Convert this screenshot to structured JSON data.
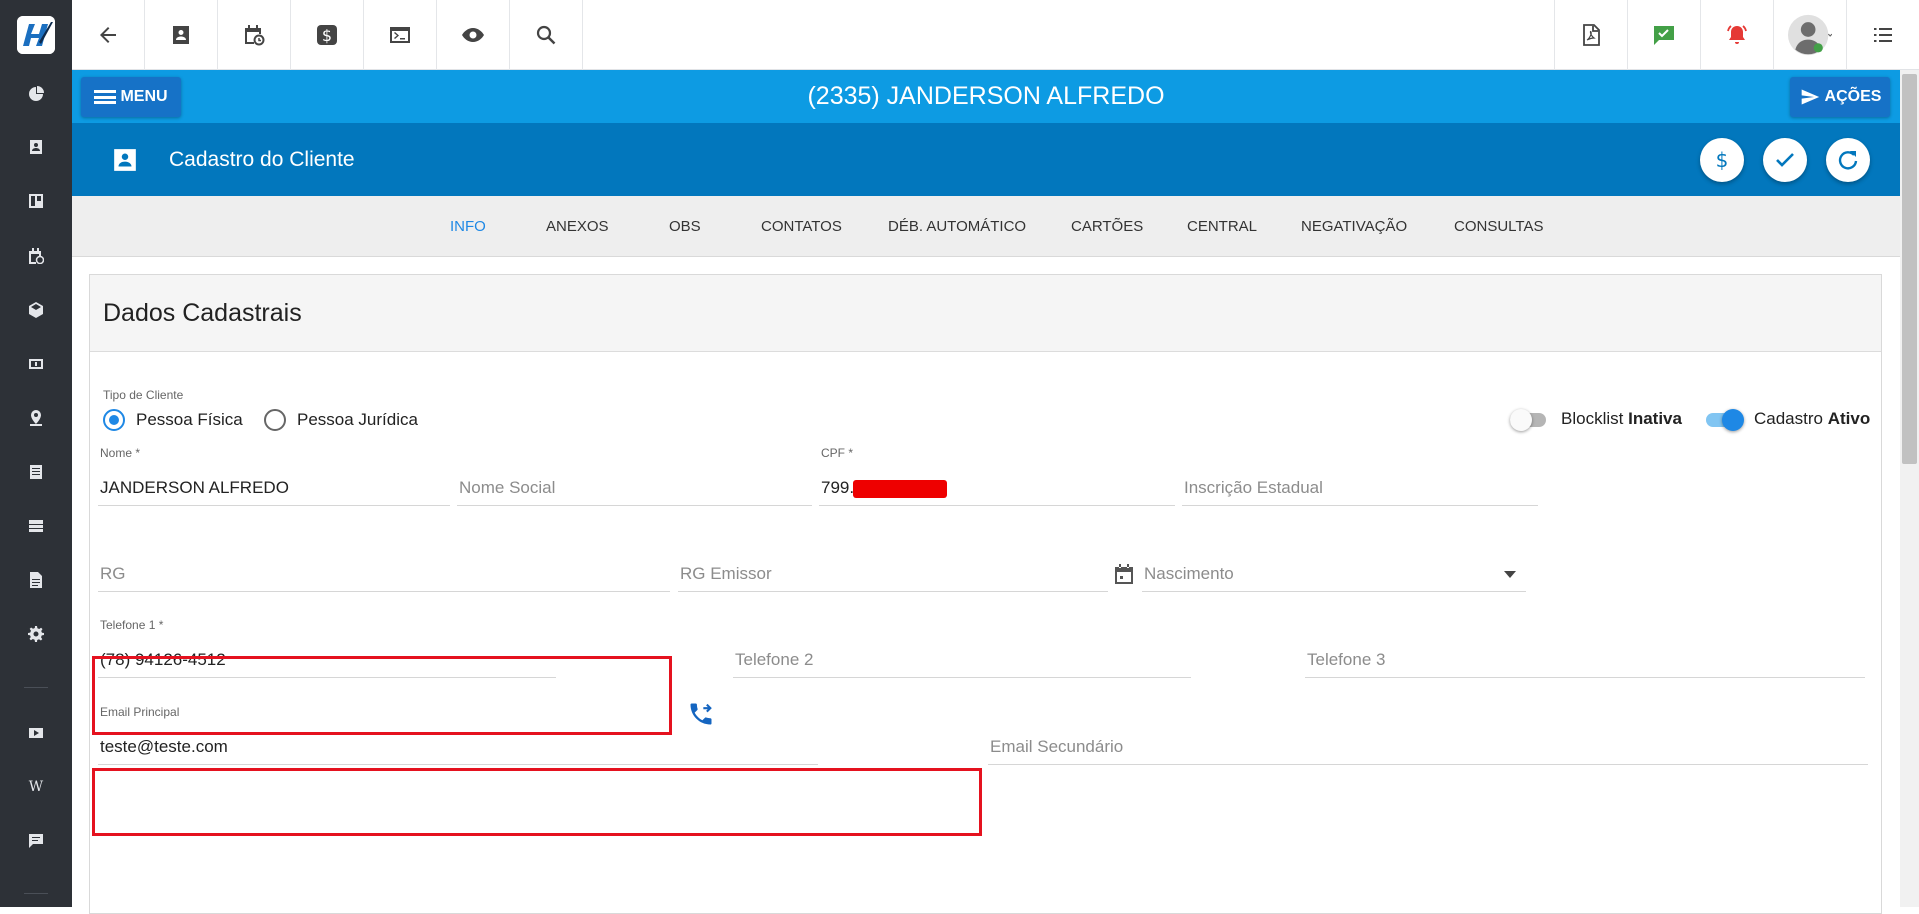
{
  "sidebar": {
    "icons": [
      "logo-icon",
      "dashboard-icon",
      "contacts-icon",
      "board-icon",
      "calendar-clock-icon",
      "box-icon",
      "money-icon",
      "location-icon",
      "list-icon",
      "server-icon",
      "document-icon",
      "gear-icon",
      "video-icon",
      "wiki-icon",
      "chat-icon"
    ],
    "wiki_glyph": "W"
  },
  "toolbar": {
    "left_icons": [
      "back-arrow-icon",
      "contact-card-icon",
      "calendar-clock-icon",
      "dollar-icon",
      "terminal-icon",
      "eye-icon",
      "search-icon"
    ],
    "right_icons": [
      "pdf-icon",
      "chat-check-icon",
      "alarm-bell-icon",
      "user-avatar-icon",
      "list-menu-icon"
    ]
  },
  "header": {
    "menu_label": "MENU",
    "title": "(2335) JANDERSON ALFREDO",
    "actions_label": "AÇÕES"
  },
  "subheader": {
    "title": "Cadastro do Cliente",
    "buttons": [
      "dollar-icon",
      "check-icon",
      "refresh-icon"
    ]
  },
  "tabs": [
    {
      "label": "INFO",
      "active": true
    },
    {
      "label": "ANEXOS",
      "active": false
    },
    {
      "label": "OBS",
      "active": false
    },
    {
      "label": "CONTATOS",
      "active": false
    },
    {
      "label": "DÉB. AUTOMÁTICO",
      "active": false
    },
    {
      "label": "CARTÕES",
      "active": false
    },
    {
      "label": "CENTRAL",
      "active": false
    },
    {
      "label": "NEGATIVAÇÃO",
      "active": false
    },
    {
      "label": "CONSULTAS",
      "active": false
    }
  ],
  "form": {
    "section_title": "Dados Cadastrais",
    "tipo_cliente_label": "Tipo de Cliente",
    "pessoa_fisica": "Pessoa Física",
    "pessoa_juridica": "Pessoa Jurídica",
    "selected_tipo": "Pessoa Física",
    "blocklist_label": "Blocklist",
    "blocklist_state": "Inativa",
    "blocklist_on": false,
    "cadastro_label": "Cadastro",
    "cadastro_state": "Ativo",
    "cadastro_on": true,
    "nome_label": "Nome *",
    "nome_value": "JANDERSON ALFREDO",
    "nome_social_placeholder": "Nome Social",
    "cpf_label": "CPF *",
    "cpf_value": "799.",
    "inscricao_placeholder": "Inscrição Estadual",
    "rg_placeholder": "RG",
    "rg_emissor_placeholder": "RG Emissor",
    "nascimento_placeholder": "Nascimento",
    "telefone1_label": "Telefone 1 *",
    "telefone1_value": "(78) 94126-4512",
    "telefone2_placeholder": "Telefone 2",
    "telefone3_placeholder": "Telefone 3",
    "email_label": "Email Principal",
    "email_value": "teste@teste.com",
    "email2_placeholder": "Email Secundário"
  },
  "colors": {
    "sidebar_bg": "#2d3137",
    "titlebar_bg": "#0d9be3",
    "subheader_bg": "#0277bd",
    "accent": "#1e88e5",
    "highlight_red": "#e5121f",
    "money_green": "#43a047",
    "alarm_red": "#e53935"
  }
}
